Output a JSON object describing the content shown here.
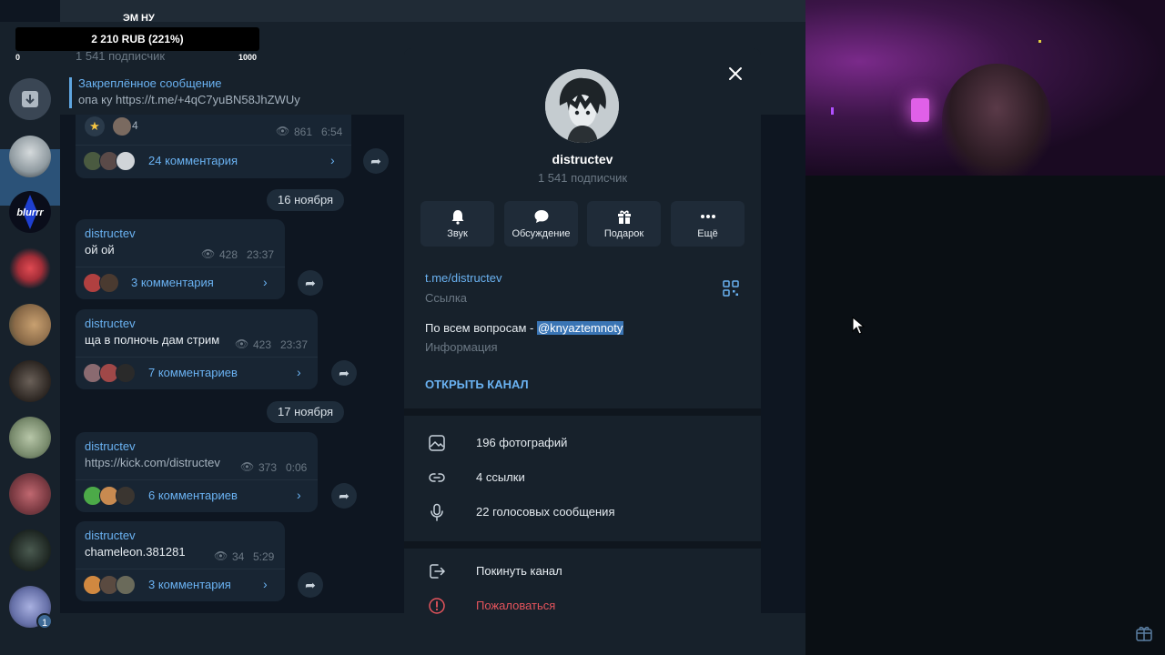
{
  "overlay": {
    "title": "ЭМ НУ",
    "value_text": "2 210 RUB (221%)",
    "min_label": "0",
    "max_label": "1000"
  },
  "channel_header": {
    "subscribers": "1 541 подписчик",
    "pinned_title": "Закреплённое сообщение",
    "pinned_text": "опа ку https://t.me/+4qC7yuBN58JhZWUy"
  },
  "sidebar": {
    "unread_badge": "1"
  },
  "messages": [
    {
      "reaction_count": "4",
      "views": "861",
      "time": "6:54",
      "comments": "24 комментария"
    },
    {
      "date": "16 ноября"
    },
    {
      "author": "distructev",
      "text": "ой ой",
      "views": "428",
      "time": "23:37",
      "comments": "3 комментария"
    },
    {
      "author": "distructev",
      "text": "ща в полночь дам стрим",
      "views": "423",
      "time": "23:37",
      "comments": "7 комментариев"
    },
    {
      "date": "17 ноября"
    },
    {
      "author": "distructev",
      "text": "https://kick.com/distructev",
      "views": "373",
      "time": "0:06",
      "comments": "6 комментариев"
    },
    {
      "author": "distructev",
      "text": "chameleon.381281",
      "views": "34",
      "time": "5:29",
      "comments": "3 комментария"
    }
  ],
  "modal": {
    "name": "distructev",
    "subscribers": "1 541 подписчик",
    "actions": [
      {
        "label": "Звук",
        "icon": "bell-icon"
      },
      {
        "label": "Обсуждение",
        "icon": "chat-bubble-icon"
      },
      {
        "label": "Подарок",
        "icon": "gift-icon"
      },
      {
        "label": "Ещё",
        "icon": "more-icon"
      }
    ],
    "link": "t.me/distructev",
    "link_label": "Ссылка",
    "info_prefix": "По всем вопросам - ",
    "info_mention": "@knyaztemnoty",
    "info_label": "Информация",
    "open_channel": "ОТКРЫТЬ КАНАЛ",
    "media_rows": [
      {
        "label": "196 фотографий",
        "icon": "photo-icon"
      },
      {
        "label": "4 ссылки",
        "icon": "link-icon"
      },
      {
        "label": "22 голосовых сообщения",
        "icon": "microphone-icon"
      }
    ],
    "leave": "Покинуть канал",
    "report": "Пожаловаться"
  },
  "colors": {
    "accent": "#6ab2f2",
    "danger": "#e5545c",
    "panel": "#17212b",
    "chat_bg": "#0e1621"
  }
}
